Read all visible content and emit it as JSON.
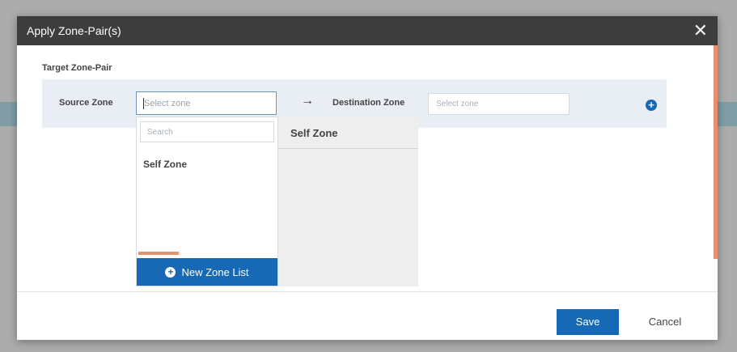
{
  "dialog": {
    "title": "Apply Zone-Pair(s)",
    "close_icon": "close-icon",
    "section_label": "Target Zone-Pair"
  },
  "source": {
    "label": "Source Zone",
    "placeholder": "Select zone"
  },
  "destination": {
    "label": "Destination Zone",
    "placeholder": "Select zone"
  },
  "arrow": "→",
  "add_icon": "plus-circle-icon",
  "dropdown": {
    "search_placeholder": "Search",
    "items": [
      "Self Zone"
    ],
    "new_zone_label": "New Zone List"
  },
  "destination_list": {
    "items": [
      "Self Zone"
    ]
  },
  "footer": {
    "save_label": "Save",
    "cancel_label": "Cancel"
  },
  "colors": {
    "header_bg": "#3d3d3d",
    "primary": "#1769b5",
    "accent": "#e8906a",
    "row_bg": "#e9eef4"
  }
}
